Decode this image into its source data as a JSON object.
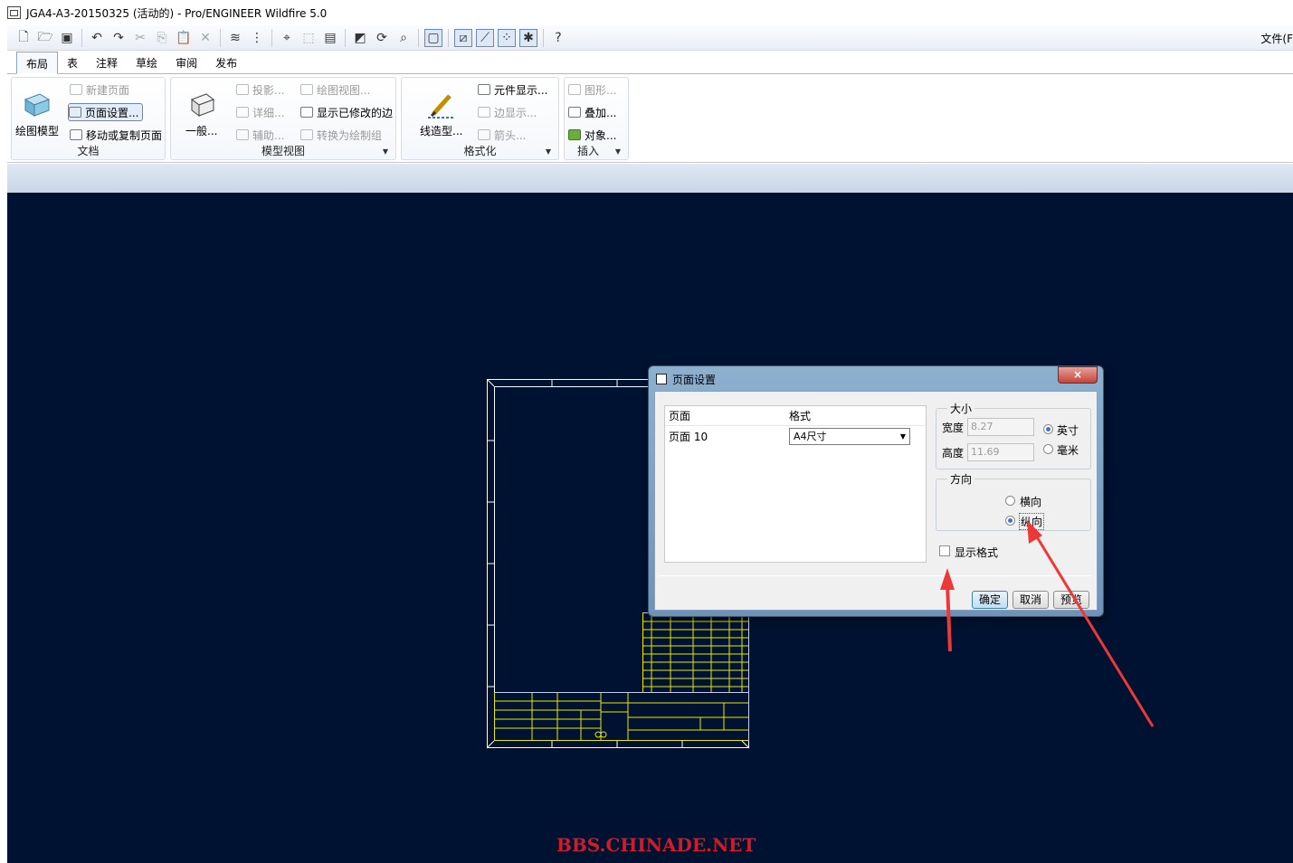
{
  "window": {
    "title": "JGA4-A3-20150325 (活动的) - Pro/ENGINEER Wildfire 5.0"
  },
  "file_menu": {
    "label": "文件(F"
  },
  "toolbar_icons": [
    "new-icon",
    "open-icon",
    "save-icon",
    "undo-icon",
    "redo-icon",
    "cut-icon",
    "copy-icon",
    "paste-icon",
    "delete-icon",
    "layers-icon",
    "tree-icon",
    "find-icon",
    "select-box-icon",
    "properties-icon",
    "repaint-icon",
    "refit-icon",
    "zoom-icon",
    "view-icon",
    "datum-plane-icon",
    "datum-axis-icon",
    "datum-point-icon",
    "coord-sys-icon",
    "whats-this-icon"
  ],
  "tabs": [
    "布局",
    "表",
    "注释",
    "草绘",
    "审阅",
    "发布"
  ],
  "active_tab": "布局",
  "ribbon": {
    "doc": {
      "big": "绘图模型",
      "new_page": "新建页面",
      "page_setup": "页面设置...",
      "move_copy": "移动或复制页面",
      "group": "文档"
    },
    "model_views": {
      "big": "一般...",
      "projection": "投影...",
      "detail": "详细...",
      "auxiliary": "辅助...",
      "drawing_view": "绘图视图...",
      "show_modified": "显示已修改的边",
      "convert": "转换为绘制组",
      "group": "模型视图"
    },
    "format": {
      "big": "线造型...",
      "component_display": "元件显示...",
      "edge_display": "边显示...",
      "arrow": "箭头...",
      "group": "格式化"
    },
    "insert": {
      "graphics": "图形...",
      "overlay": "叠加...",
      "object": "对象...",
      "group": "插入"
    }
  },
  "dialog": {
    "title": "页面设置",
    "close": "×",
    "table": {
      "col_page": "页面",
      "col_format": "格式",
      "rows": [
        {
          "page": "页面 10",
          "format": "A4尺寸"
        }
      ]
    },
    "size": {
      "legend": "大小",
      "width_label": "宽度",
      "width": "8.27",
      "height_label": "高度",
      "height": "11.69",
      "inch": "英寸",
      "mm": "毫米",
      "unit_selected": "英寸"
    },
    "orientation": {
      "legend": "方向",
      "landscape": "横向",
      "portrait": "纵向",
      "selected": "纵向"
    },
    "show_format": "显示格式",
    "show_format_checked": false,
    "buttons": {
      "ok": "确定",
      "cancel": "取消",
      "preview": "预览"
    }
  },
  "watermark": "BBS.CHINADE.NET",
  "colors": {
    "canvas": "#001231",
    "drawing_border": "#ffffff",
    "drawing_table": "#e8e800",
    "arrow": "#ee3838"
  }
}
